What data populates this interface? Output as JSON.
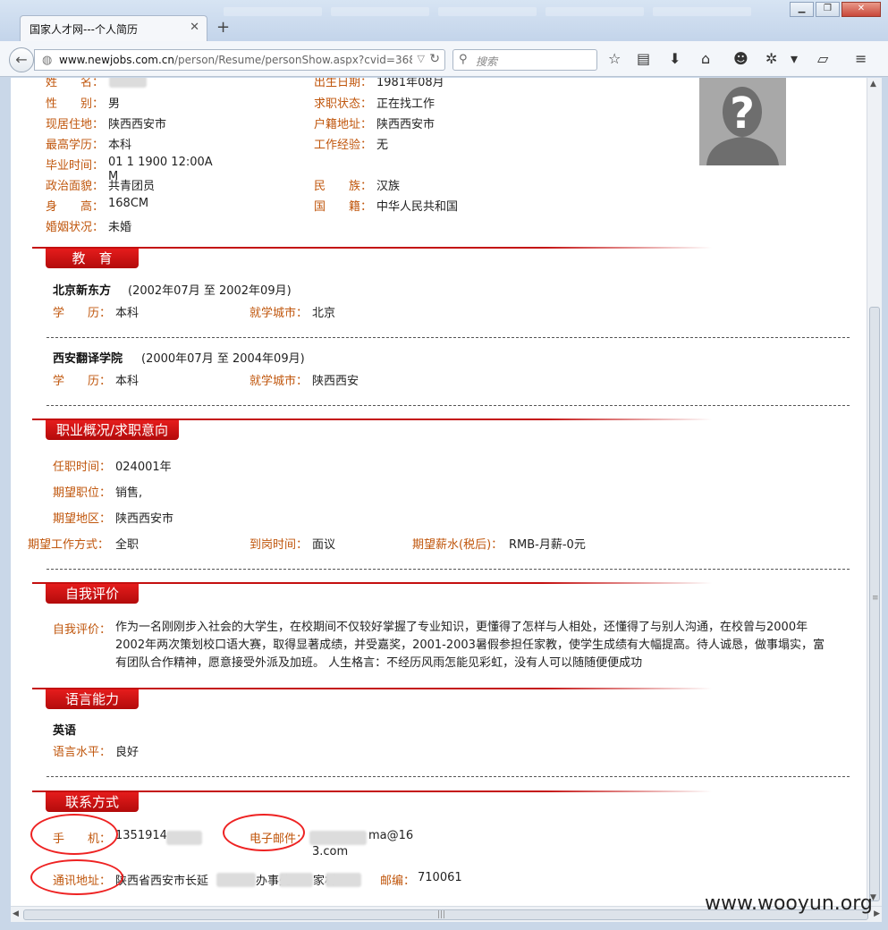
{
  "browser": {
    "tab_title": "国家人才网---个人简历",
    "url_host": "www.newjobs.com.cn",
    "url_path": "/person/Resume/personShow.aspx?cvid=3685",
    "search_placeholder": "搜索"
  },
  "basic": {
    "name_label": "姓　　名：",
    "gender_label": "性　　别：",
    "gender": "男",
    "residence_label": "现居住地：",
    "residence": "陕西西安市",
    "education_label": "最高学历：",
    "education": "本科",
    "graduation_label": "毕业时间：",
    "graduation": "01 1 1900 12:00A",
    "graduation_cont": "M",
    "political_label": "政治面貌：",
    "political": "共青团员",
    "height_label": "身　　高：",
    "height": "168CM",
    "marital_label": "婚姻状况：",
    "marital": "未婚",
    "birth_label": "出生日期：",
    "birth": "1981年08月",
    "jobstatus_label": "求职状态：",
    "jobstatus": "正在找工作",
    "hukou_label": "户籍地址：",
    "hukou": "陕西西安市",
    "experience_label": "工作经验：",
    "experience": "无",
    "ethnic_label": "民　　族：",
    "ethnic": "汉族",
    "nationality_label": "国　　籍：",
    "nationality": "中华人民共和国"
  },
  "education": {
    "title": "教　育",
    "entries": [
      {
        "school": "北京新东方",
        "period": "(2002年07月  至  2002年09月)",
        "degree_label": "学　　历：",
        "degree": "本科",
        "city_label": "就学城市：",
        "city": "北京"
      },
      {
        "school": "西安翻译学院",
        "period": "(2000年07月  至  2004年09月)",
        "degree_label": "学　　历：",
        "degree": "本科",
        "city_label": "就学城市：",
        "city": "陕西西安"
      }
    ]
  },
  "career": {
    "title": "职业概况/求职意向",
    "tenure_label": "任职时间：",
    "tenure": "024001年",
    "position_label": "期望职位：",
    "position": "销售,",
    "area_label": "期望地区：",
    "area": "陕西西安市",
    "worktype_label": "期望工作方式：",
    "worktype": "全职",
    "arrival_label": "到岗时间：",
    "arrival": "面议",
    "salary_label": "期望薪水(税后)：",
    "salary": "RMB-月薪-0元"
  },
  "self_eval": {
    "title": "自我评价",
    "label": "自我评价：",
    "text": "作为一名刚刚步入社会的大学生，在校期间不仅较好掌握了专业知识，更懂得了怎样与人相处，还懂得了与别人沟通，在校曾与2000年2002年两次策划校口语大赛，取得显著成绩，并受嘉奖，2001-2003暑假参担任家教，使学生成绩有大幅提高。待人诚恳，做事塌实，富有团队合作精神，愿意接受外派及加班。 人生格言：不经历风雨怎能见彩虹，没有人可以随随便便成功"
  },
  "language": {
    "title": "语言能力",
    "name": "英语",
    "level_label": "语言水平：",
    "level": "良好"
  },
  "contact": {
    "title": "联系方式",
    "phone_label": "手　　机：",
    "phone": "1351914",
    "email_label": "电子邮件：",
    "email": "ma@16",
    "email_cont": "3.com",
    "address_label": "通讯地址：",
    "address_p1": "陕西省西安市长延",
    "address_p2": "办事处",
    "address_p3": "家村",
    "zip_label": "邮编：",
    "zip": "710061"
  },
  "watermark": "www.wooyun.org"
}
